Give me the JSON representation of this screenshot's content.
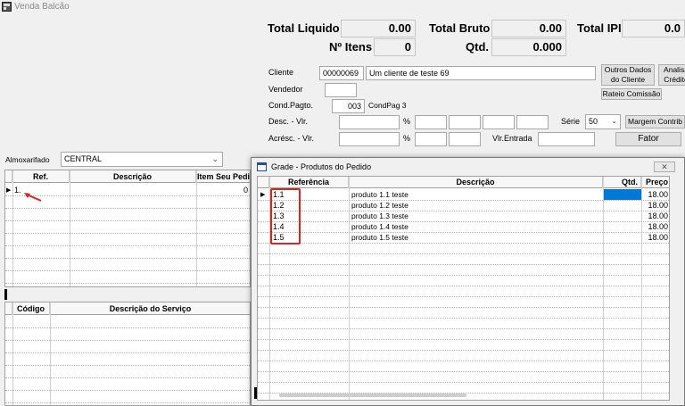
{
  "window": {
    "title": "Venda Balcão"
  },
  "totals": {
    "liquido_label": "Total Liquido",
    "liquido_value": "0.00",
    "bruto_label": "Total Bruto",
    "bruto_value": "0.00",
    "ipi_label": "Total IPI",
    "ipi_value": "0.0",
    "itens_label": "Nº Itens",
    "itens_value": "0",
    "qtd_label": "Qtd.",
    "qtd_value": "0.000"
  },
  "form": {
    "cliente_label": "Cliente",
    "cliente_code": "00000069",
    "cliente_name": "Um cliente de teste 69",
    "vendedor_label": "Vendedor",
    "condpagto_label": "Cond.Pagto.",
    "condpagto_code": "003",
    "condpagto_name": "CondPag 3",
    "desc_label": "Desc. - Vlr.",
    "acresc_label": "Acrésc. - Vlr.",
    "percent": "%",
    "vlr_entrada_label": "Vlr.Entrada",
    "serie_label": "Série",
    "serie_value": "50"
  },
  "buttons": {
    "outros_dados": "Outros Dados do Cliente",
    "analisa_credito": "Analisa Crédito",
    "rateio_comissao": "Rateio Comissão",
    "margem_contrib": "Margem Contrib",
    "fator": "Fator"
  },
  "almoxarifado": {
    "label": "Almoxarifado",
    "value": "CENTRAL"
  },
  "items_grid": {
    "columns": [
      "Ref.",
      "Descrição",
      "Item Seu Pedi"
    ],
    "rows": [
      {
        "ref": "1.",
        "desc": "",
        "item": "0"
      }
    ]
  },
  "services_grid": {
    "columns": [
      "Código",
      "Descrição do Serviço"
    ]
  },
  "dialog": {
    "title": "Grade - Produtos do Pedido",
    "columns": [
      "Referência",
      "Descrição",
      "Qtd.",
      "Preço"
    ],
    "rows": [
      {
        "ref": "1.1",
        "desc": "produto 1.1 teste",
        "qtd": "",
        "preco": "18.00"
      },
      {
        "ref": "1.2",
        "desc": "produto 1.2 teste",
        "qtd": "",
        "preco": "18.00"
      },
      {
        "ref": "1.3",
        "desc": "produto 1.3 teste",
        "qtd": "",
        "preco": "18.00"
      },
      {
        "ref": "1.4",
        "desc": "produto 1.4 teste",
        "qtd": "",
        "preco": "18.00"
      },
      {
        "ref": "1.5",
        "desc": "produto 1.5 teste",
        "qtd": "",
        "preco": "18.00"
      }
    ]
  },
  "colors": {
    "highlight": "#e02020",
    "selection": "#0078d7"
  }
}
